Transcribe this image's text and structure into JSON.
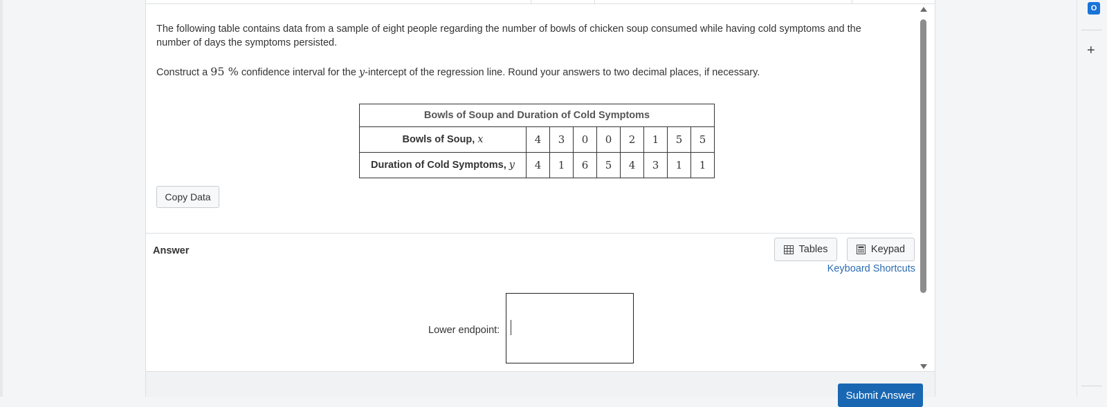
{
  "question": {
    "intro": "The following table contains data from a sample of eight people regarding the number of bowls of chicken soup consumed while having cold symptoms and the number of days the symptoms persisted.",
    "construct_prefix": "Construct a ",
    "confidence_value": "95 %",
    "construct_middle": " confidence interval for the ",
    "y_var": "y",
    "construct_suffix": "-intercept of the regression line. Round your answers to two decimal places, if necessary."
  },
  "table": {
    "title": "Bowls of Soup and Duration of Cold Symptoms",
    "row1_label": "Bowls of Soup, ",
    "row1_var": "x",
    "row1_values": [
      "4",
      "3",
      "0",
      "0",
      "2",
      "1",
      "5",
      "5"
    ],
    "row2_label": "Duration of Cold Symptoms, ",
    "row2_var": "y",
    "row2_values": [
      "4",
      "1",
      "6",
      "5",
      "4",
      "3",
      "1",
      "1"
    ]
  },
  "buttons": {
    "copy_data": "Copy Data",
    "tables": "Tables",
    "keypad": "Keypad",
    "keyboard_shortcuts": "Keyboard Shortcuts",
    "submit": "Submit Answer"
  },
  "answer": {
    "heading": "Answer",
    "lower_label": "Lower endpoint:",
    "lower_value": ""
  },
  "sidebar": {
    "outlook_letter": "O"
  },
  "colors": {
    "accent": "#1967b2",
    "link": "#2b6cb0"
  }
}
